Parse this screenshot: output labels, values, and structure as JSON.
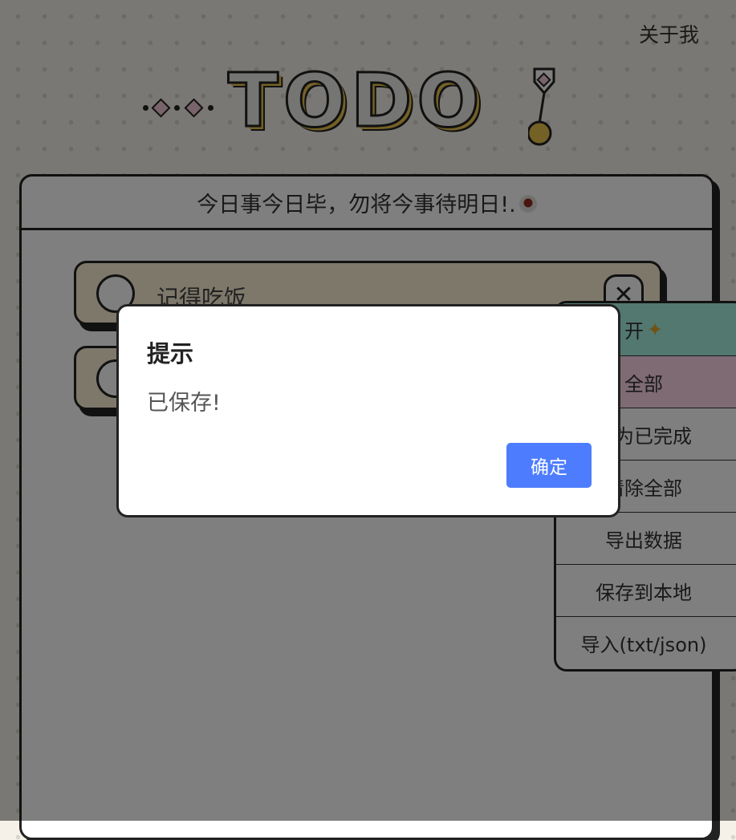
{
  "header": {
    "about_label": "关于我"
  },
  "logo": {
    "wordmark": "TODO"
  },
  "card": {
    "motto": "今日事今日毕，勿将今事待明日!.",
    "todos": [
      {
        "text": "记得吃饭",
        "done": false
      },
      {
        "text": "",
        "done": false
      }
    ]
  },
  "menu": {
    "items": [
      {
        "label": "开",
        "icon": "sparkle-icon"
      },
      {
        "label": "全部"
      },
      {
        "label": "标为已完成"
      },
      {
        "label": "清除全部"
      },
      {
        "label": "导出数据"
      },
      {
        "label": "保存到本地"
      },
      {
        "label": "导入(txt/json)"
      }
    ]
  },
  "dialog": {
    "title": "提示",
    "message": "已保存!",
    "ok_label": "确定"
  },
  "colors": {
    "accent": "#4d7cff",
    "item_background": "#fdf1d6",
    "menu_toggle": "#a6f0e1",
    "menu_active": "#fdd7e6",
    "logo_yellow": "#e8c24c",
    "logo_pink": "#f3c9d6"
  }
}
